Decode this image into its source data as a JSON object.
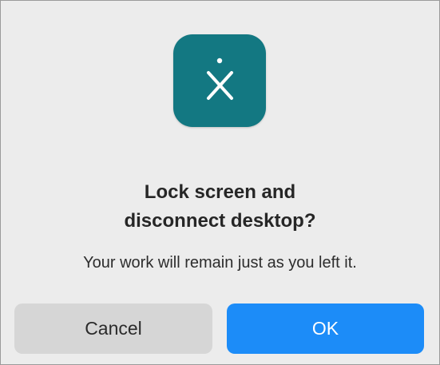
{
  "dialog": {
    "app_icon": "remote-desktop-x-icon",
    "title_line1": "Lock screen and",
    "title_line2": "disconnect desktop?",
    "message": "Your work will remain just as you left it.",
    "cancel_label": "Cancel",
    "ok_label": "OK"
  },
  "colors": {
    "icon_background": "#137882",
    "ok_button": "#1c8cf8",
    "cancel_button": "#d6d6d6",
    "dialog_background": "#ececec"
  }
}
